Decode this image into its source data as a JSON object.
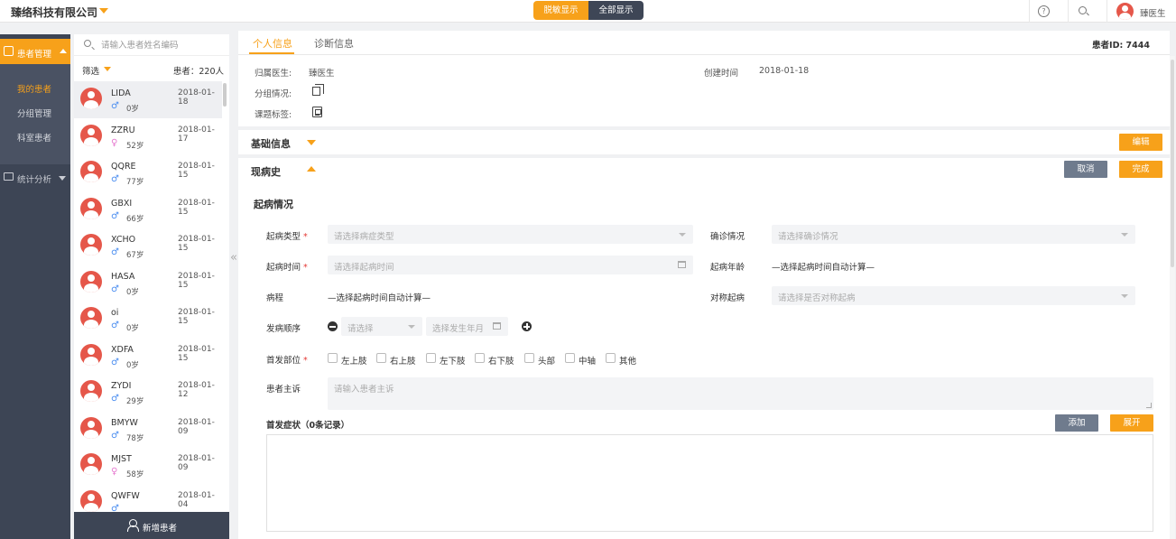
{
  "header": {
    "company": "臻络科技有限公司",
    "toggle": [
      "脱敏显示",
      "全部显示"
    ],
    "doctor": "臻医生"
  },
  "nav": {
    "patient_mgmt": "患者管理",
    "sub": [
      "我的患者",
      "分组管理",
      "科室患者"
    ],
    "stats": "统计分析"
  },
  "patient_list": {
    "search_placeholder": "请输入患者姓名编码",
    "filter": "筛选",
    "count": "患者：220人",
    "patients": [
      {
        "name": "LIDA",
        "date": "2018-01-18",
        "gender": "♂",
        "age": "0岁"
      },
      {
        "name": "ZZRU",
        "date": "2018-01-17",
        "gender": "♀",
        "age": "52岁"
      },
      {
        "name": "QQRE",
        "date": "2018-01-15",
        "gender": "♂",
        "age": "77岁"
      },
      {
        "name": "GBXI",
        "date": "2018-01-15",
        "gender": "♂",
        "age": "66岁"
      },
      {
        "name": "XCHO",
        "date": "2018-01-15",
        "gender": "♂",
        "age": "67岁"
      },
      {
        "name": "HASA",
        "date": "2018-01-15",
        "gender": "♂",
        "age": "0岁"
      },
      {
        "name": "oi",
        "date": "2018-01-15",
        "gender": "♂",
        "age": "0岁"
      },
      {
        "name": "XDFA",
        "date": "2018-01-15",
        "gender": "♂",
        "age": "0岁"
      },
      {
        "name": "ZYDI",
        "date": "2018-01-12",
        "gender": "♂",
        "age": "29岁"
      },
      {
        "name": "BMYW",
        "date": "2018-01-09",
        "gender": "♂",
        "age": "78岁"
      },
      {
        "name": "MJST",
        "date": "2018-01-09",
        "gender": "♀",
        "age": "58岁"
      },
      {
        "name": "QWFW",
        "date": "2018-01-04",
        "gender": "♂",
        "age": ""
      }
    ],
    "new_patient": "新增患者"
  },
  "main": {
    "tabs": [
      "个人信息",
      "诊断信息"
    ],
    "patient_id": "患者ID: 7444",
    "info": {
      "doctor_label": "归属医生:",
      "doctor_value": "臻医生",
      "created_label": "创建时间",
      "created_value": "2018-01-18",
      "group_label": "分组情况:",
      "tag_label": "课题标签:"
    },
    "basic_info": "基础信息",
    "edit": "编辑",
    "history": "现病史",
    "cancel": "取消",
    "done": "完成",
    "onset_title": "起病情况",
    "form": {
      "onset_type_label": "起病类型",
      "onset_type_ph": "请选择病症类型",
      "diagnosis_label": "确诊情况",
      "diagnosis_ph": "请选择确诊情况",
      "onset_time_label": "起病时间",
      "onset_time_ph": "请选择起病时间",
      "onset_age_label": "起病年龄",
      "onset_age_value": "—选择起病时间自动计算—",
      "course_label": "病程",
      "course_value": "—选择起病时间自动计算—",
      "symmetric_label": "对称起病",
      "symmetric_ph": "请选择是否对称起病",
      "order_label": "发病顺序",
      "order_select_ph": "请选择",
      "order_date_ph": "选择发生年月",
      "first_site_label": "首发部位",
      "sites": [
        "左上肢",
        "右上肢",
        "左下肢",
        "右下肢",
        "头部",
        "中轴",
        "其他"
      ],
      "complaint_label": "患者主诉",
      "complaint_ph": "请输入患者主诉",
      "symptoms_title": "首发症状（0条记录）",
      "add": "添加",
      "expand": "展开"
    }
  }
}
